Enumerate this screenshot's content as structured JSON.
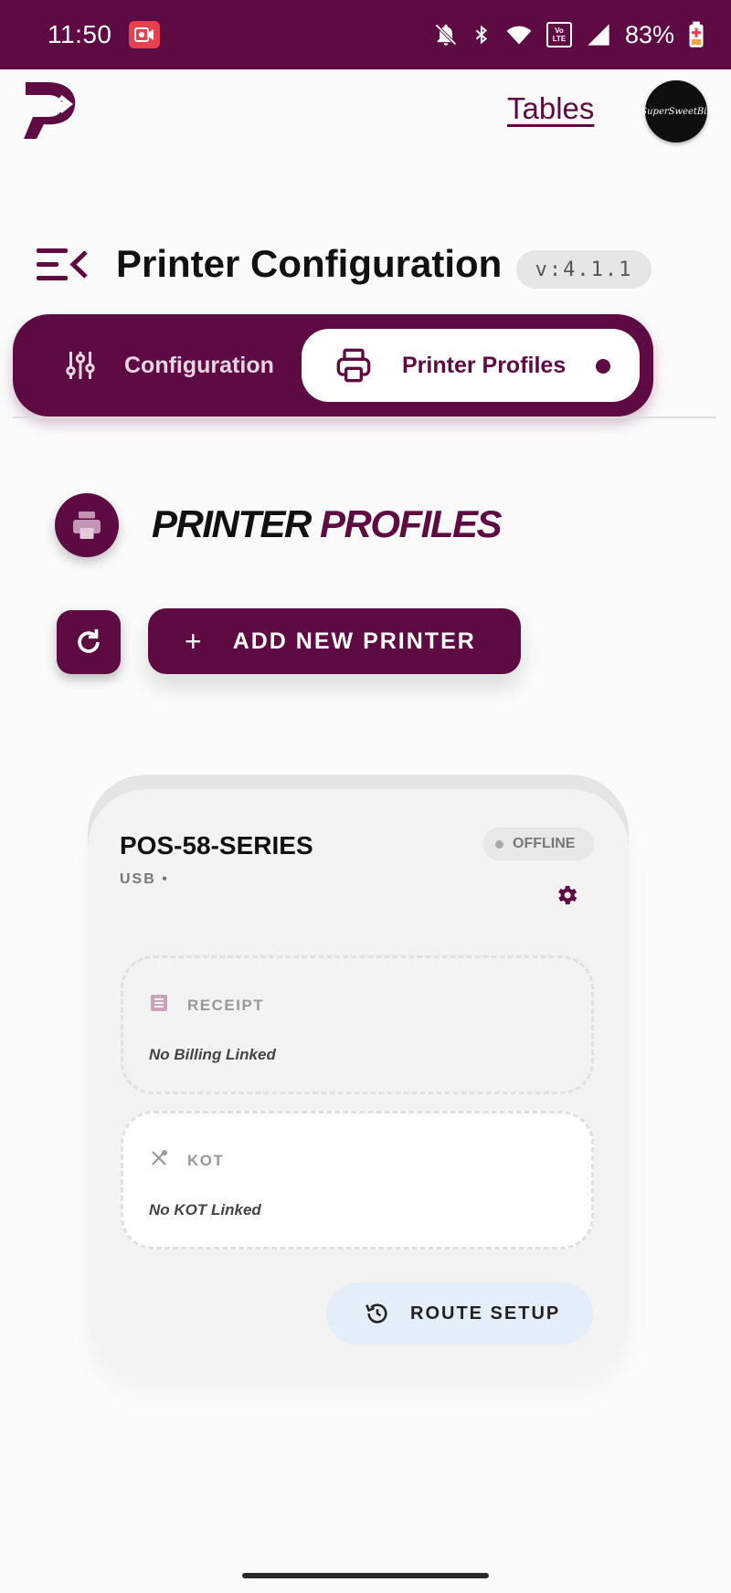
{
  "status_bar": {
    "time": "11:50",
    "battery": "83%",
    "lte_label": "Vo LTE"
  },
  "header": {
    "tables_link": "Tables",
    "avatar_text": "SuperSweetBiz"
  },
  "page": {
    "title": "Printer Configuration",
    "version": "v:4.1.1"
  },
  "tabs": {
    "configuration": "Configuration",
    "printer_profiles": "Printer Profiles",
    "active": "printer_profiles"
  },
  "section": {
    "title_part1": "PRINTER",
    "title_part2": "PROFILES"
  },
  "actions": {
    "add_printer": "ADD NEW PRINTER",
    "add_icon": "+"
  },
  "printer": {
    "name": "POS-58-SERIES",
    "subtitle": "USB •",
    "status": "OFFLINE",
    "receipt": {
      "label": "RECEIPT",
      "value": "No Billing Linked"
    },
    "kot": {
      "label": "KOT",
      "value": "No KOT Linked"
    },
    "route_button": "ROUTE SETUP"
  },
  "colors": {
    "brand": "#5e0a43",
    "status_bar": "#5e0a43",
    "route_btn_bg": "#e3eef8"
  }
}
